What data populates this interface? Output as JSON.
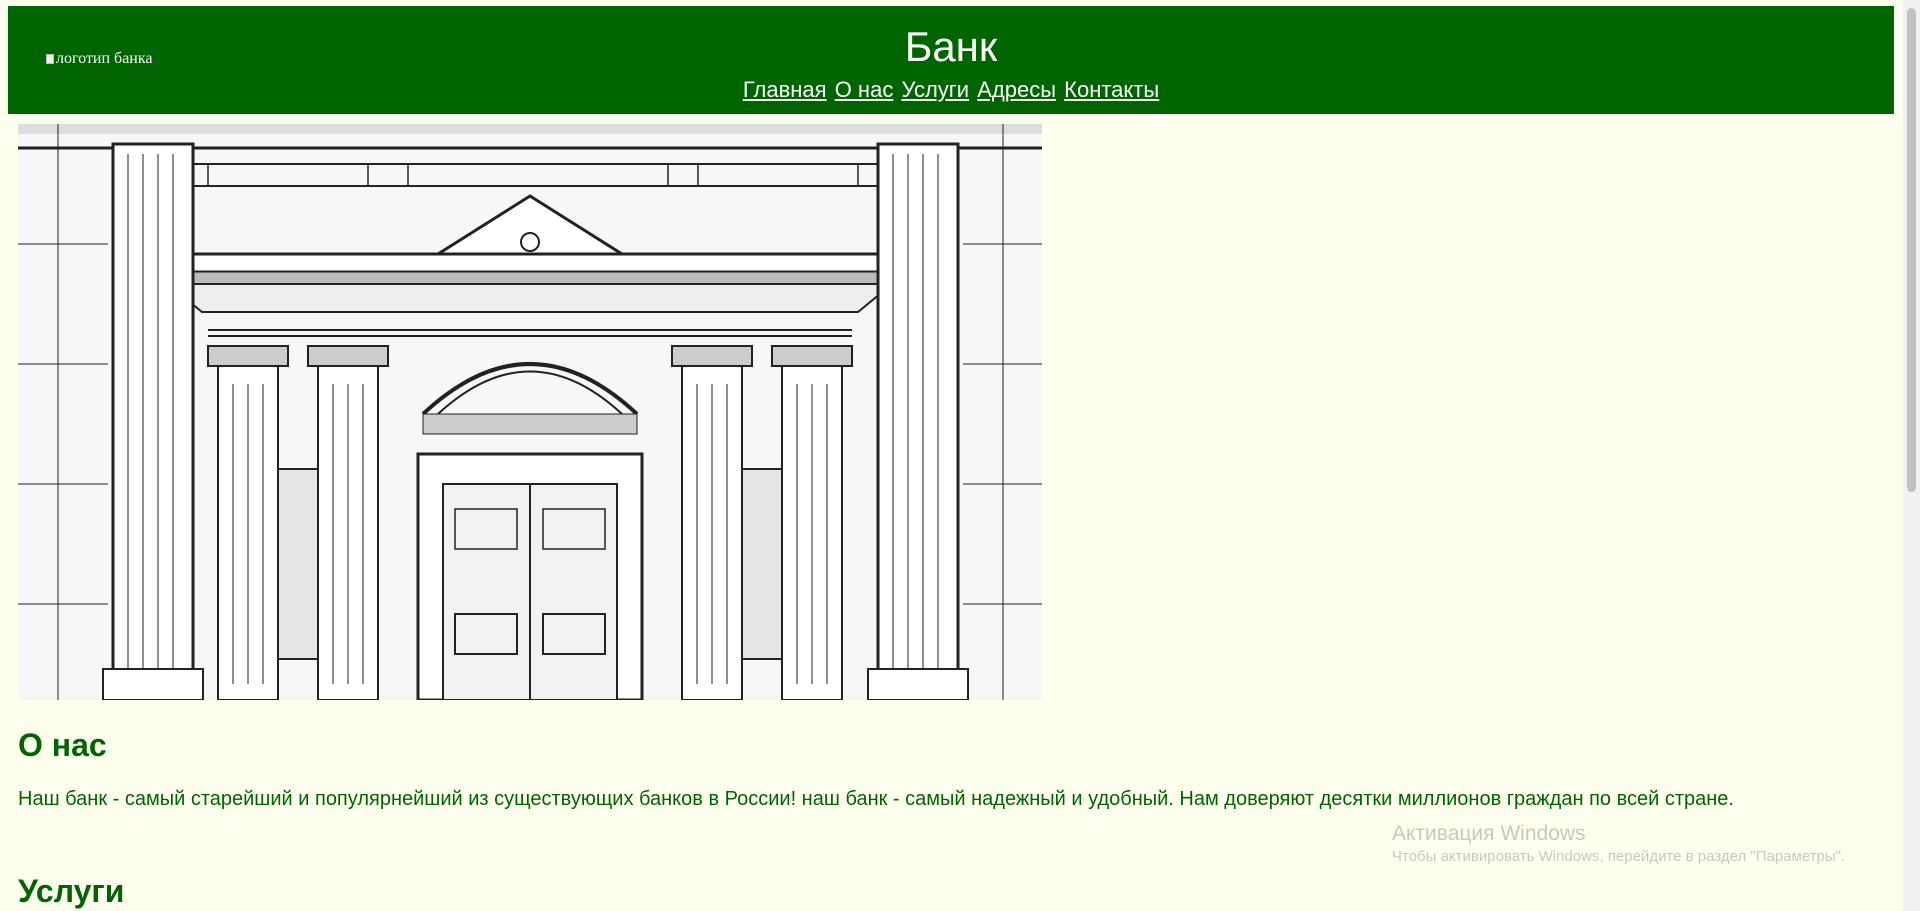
{
  "header": {
    "logo_alt": "логотип банка",
    "title": "Банк",
    "nav": [
      "Главная",
      "О нас",
      "Услуги",
      "Адресы",
      "Контакты"
    ]
  },
  "about": {
    "heading": "О нас",
    "text": "Наш банк - самый старейший и популярнейший из существующих банков в России! наш банк - самый надежный и удобный. Нам доверяют десятки миллионов граждан по всей стране."
  },
  "services": {
    "heading": "Услуги"
  },
  "watermark": {
    "title": "Активация Windows",
    "subtitle": "Чтобы активировать Windows, перейдите в раздел \"Параметры\"."
  },
  "colors": {
    "header_bg": "#006400",
    "page_bg": "#fffff0",
    "text": "#006400"
  }
}
